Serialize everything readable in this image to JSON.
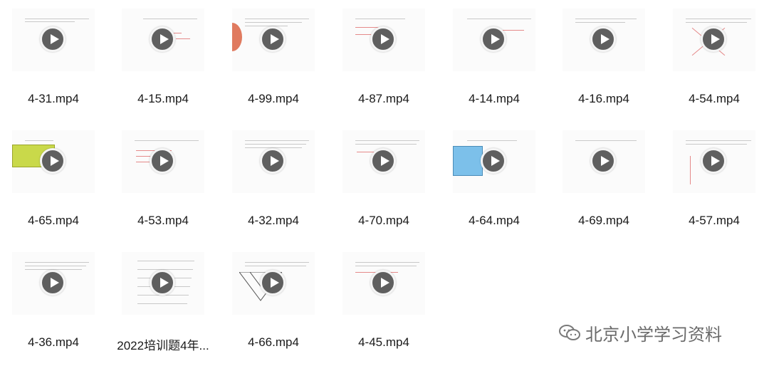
{
  "files": [
    {
      "name": "4-31.mp4"
    },
    {
      "name": "4-15.mp4"
    },
    {
      "name": "4-99.mp4"
    },
    {
      "name": "4-87.mp4"
    },
    {
      "name": "4-14.mp4"
    },
    {
      "name": "4-16.mp4"
    },
    {
      "name": "4-54.mp4"
    },
    {
      "name": "4-65.mp4"
    },
    {
      "name": "4-53.mp4"
    },
    {
      "name": "4-32.mp4"
    },
    {
      "name": "4-70.mp4"
    },
    {
      "name": "4-64.mp4"
    },
    {
      "name": "4-69.mp4"
    },
    {
      "name": "4-57.mp4"
    },
    {
      "name": "4-36.mp4"
    },
    {
      "name": "2022培训题4年..."
    },
    {
      "name": "4-66.mp4"
    },
    {
      "name": "4-45.mp4"
    }
  ],
  "watermark": {
    "text": "北京小学学习资料",
    "icon": "wechat-icon"
  }
}
